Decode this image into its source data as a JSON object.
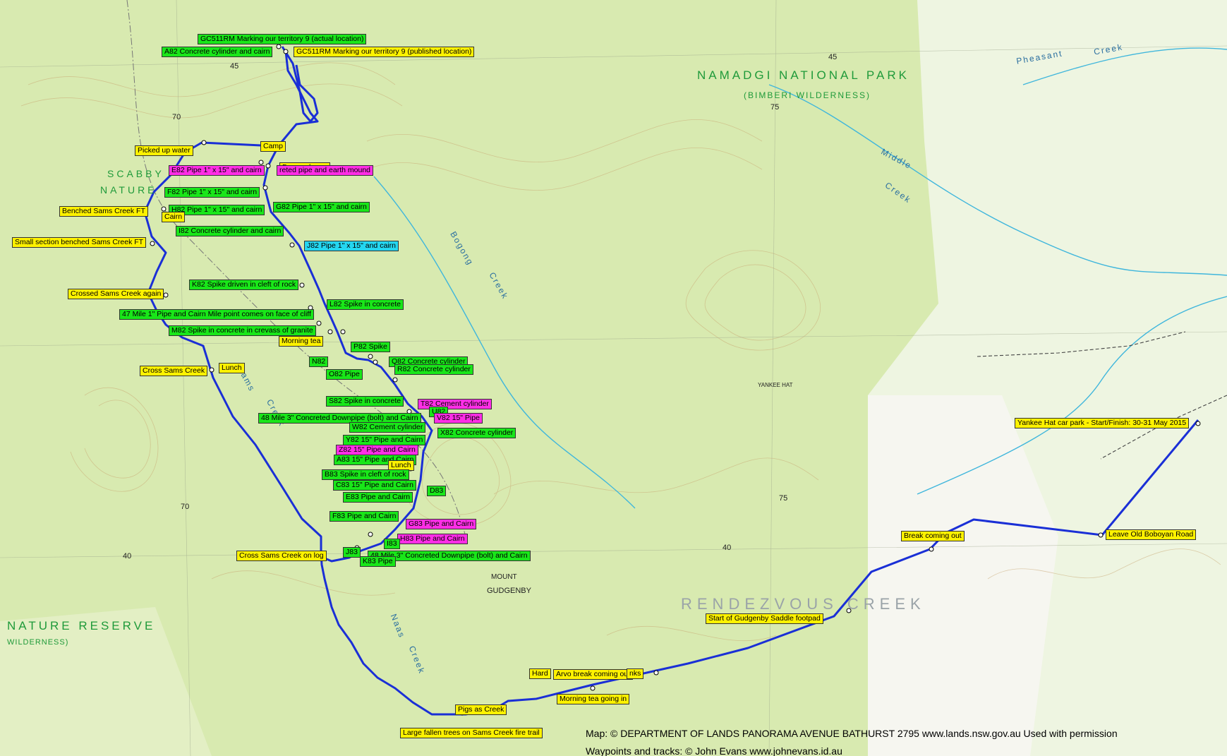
{
  "map": {
    "area_labels": {
      "namadgi": "NAMADGI   NATIONAL   PARK",
      "bimberi": "(BIMBERI    WILDERNESS)",
      "scabby": "SCABBY",
      "nature": "NATURE",
      "rendezvous": "RENDEZVOUS   CREEK",
      "nature_reserve": "NATURE   RESERVE",
      "wilderness": "WILDERNESS)",
      "mount_gudgenby": "MOUNT",
      "gudgenby": "GUDGENBY",
      "yankee_hat": "YANKEE HAT"
    },
    "creek_labels": {
      "bogong": "Bogong",
      "bogong_creek": "Creek",
      "middle": "Middle",
      "middle_creek": "Creek",
      "pheasant": "Pheasant",
      "pheasant_creek": "Creek",
      "sams": "Sams",
      "sams_creek": "Creek",
      "naas": "Naas",
      "naas_creek": "Creek"
    },
    "grid_labels": {
      "g45_left": "45",
      "g45_top": "45",
      "g70_top": "70",
      "g70_mid": "70",
      "g75_top": "75",
      "g75_mid": "75",
      "g40_left": "40",
      "g40_right": "40"
    },
    "waypoints": [
      {
        "label": "GC511RM Marking our territory 9 (actual location)",
        "color": "green"
      },
      {
        "label": "A82 Concrete cylinder and cairn",
        "color": "green"
      },
      {
        "label": "GC511RM Marking our territory 9 (published location)",
        "color": "yellow"
      },
      {
        "label": "Camp",
        "color": "yellow"
      },
      {
        "label": "Picked up water",
        "color": "yellow"
      },
      {
        "label": "E82 Pipe 1\" x 15\" and cairn",
        "color": "magenta"
      },
      {
        "label": "Dropped gear",
        "color": "yellow"
      },
      {
        "label": "reted pipe and earth mound",
        "color": "magenta"
      },
      {
        "label": "F82 Pipe 1\" x 15\" and cairn",
        "color": "green"
      },
      {
        "label": "Benched Sams Creek FT",
        "color": "yellow"
      },
      {
        "label": "H82 Pipe 1\" x 15\" and cairn",
        "color": "green"
      },
      {
        "label": "G82 Pipe 1\" x 15\" and cairn",
        "color": "green"
      },
      {
        "label": "Cairn",
        "color": "yellow"
      },
      {
        "label": "I82 Concrete cylinder and cairn",
        "color": "green"
      },
      {
        "label": "Small section benched Sams Creek FT",
        "color": "yellow"
      },
      {
        "label": "J82 Pipe 1\" x 15\" and cairn",
        "color": "cyan"
      },
      {
        "label": "K82 Spike driven in cleft of rock",
        "color": "green"
      },
      {
        "label": "Crossed Sams Creek again",
        "color": "yellow"
      },
      {
        "label": "L82 Spike in concrete",
        "color": "green"
      },
      {
        "label": "47 Mile 1\" Pipe and Cairn Mile point comes on face of cliff",
        "color": "green"
      },
      {
        "label": "M82 Spike in concrete in crevass of granite",
        "color": "green"
      },
      {
        "label": "Morning tea",
        "color": "yellow"
      },
      {
        "label": "P82 Spike",
        "color": "green"
      },
      {
        "label": "N82",
        "color": "green"
      },
      {
        "label": "Q82 Concrete cylinder",
        "color": "green"
      },
      {
        "label": "R82 Concrete cylinder",
        "color": "green"
      },
      {
        "label": "O82 Pipe",
        "color": "green"
      },
      {
        "label": "Cross Sams Creek",
        "color": "yellow"
      },
      {
        "label": "Lunch",
        "color": "yellow"
      },
      {
        "label": "S82 Spike in concrete",
        "color": "green"
      },
      {
        "label": "T82 Cement cylinder",
        "color": "magenta"
      },
      {
        "label": "U82",
        "color": "green"
      },
      {
        "label": "48 Mile 3\" Concreted Downpipe (bolt) and Cairn",
        "color": "green"
      },
      {
        "label": "V82 15\" Pipe",
        "color": "magenta"
      },
      {
        "label": "W82 Cement cylinder",
        "color": "green"
      },
      {
        "label": "X82 Concrete cylinder",
        "color": "green"
      },
      {
        "label": "Y82 15\" Pipe and Cairn",
        "color": "green"
      },
      {
        "label": "Z82 15\" Pipe and Cairn",
        "color": "magenta"
      },
      {
        "label": "A83 15\" Pipe and Cairn",
        "color": "green"
      },
      {
        "label": "Lunch",
        "color": "yellow"
      },
      {
        "label": "B83 Spike in cleft of rock",
        "color": "green"
      },
      {
        "label": "C83 15\" Pipe and Cairn",
        "color": "green"
      },
      {
        "label": "D83",
        "color": "green"
      },
      {
        "label": "E83 Pipe and Cairn",
        "color": "green"
      },
      {
        "label": "F83 Pipe and Cairn",
        "color": "green"
      },
      {
        "label": "G83 Pipe and Cairn",
        "color": "magenta"
      },
      {
        "label": "H83 Pipe and Cairn",
        "color": "magenta"
      },
      {
        "label": "I83",
        "color": "green"
      },
      {
        "label": "J83",
        "color": "green"
      },
      {
        "label": "48 Mile 3\" Concreted Downpipe (bolt) and Cairn",
        "color": "green"
      },
      {
        "label": "K83 Pipe",
        "color": "green"
      },
      {
        "label": "Cross Sams Creek on log",
        "color": "yellow"
      },
      {
        "label": "Hard",
        "color": "yellow"
      },
      {
        "label": "Arvo break coming out",
        "color": "yellow"
      },
      {
        "label": "nks",
        "color": "yellow"
      },
      {
        "label": "Morning tea going in",
        "color": "yellow"
      },
      {
        "label": "Pigs as Creek",
        "color": "yellow"
      },
      {
        "label": "Large fallen trees on Sams Creek fire trail",
        "color": "yellow"
      },
      {
        "label": "Start of Gudgenby Saddle footpad",
        "color": "yellow"
      },
      {
        "label": "Break coming out",
        "color": "yellow"
      },
      {
        "label": "Leave Old Boboyan Road",
        "color": "yellow"
      },
      {
        "label": "Yankee Hat car park - Start/Finish: 30-31 May 2015",
        "color": "yellow"
      }
    ],
    "credits": {
      "map": "Map: © DEPARTMENT OF LANDS PANORAMA AVENUE BATHURST 2795 www.lands.nsw.gov.au  Used with permission",
      "tracks": "Waypoints and tracks: © John Evans www.johnevans.id.au"
    },
    "colors": {
      "track": "#1a2fd6",
      "contour": "#c9a874",
      "vegetation": "#cfe6a6",
      "clearing": "#f4f4ee",
      "label_green": "#1f9a3a",
      "waypoint_yellow": "#fff200",
      "waypoint_green": "#19e619",
      "waypoint_magenta": "#ff2ee6",
      "waypoint_cyan": "#24d6f0"
    }
  }
}
